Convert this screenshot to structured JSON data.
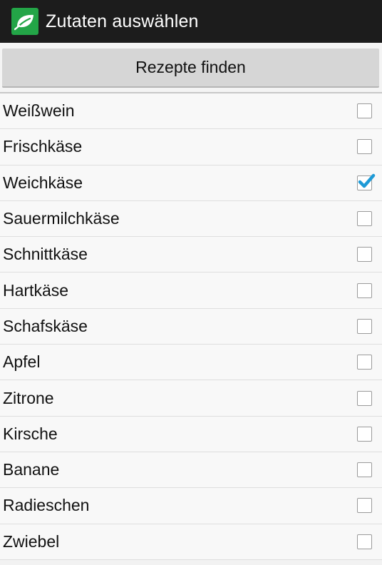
{
  "action_bar": {
    "icon": "leaf-app-icon",
    "title": "Zutaten auswählen",
    "background": "#1c1c1c",
    "icon_color": "#23a547"
  },
  "main": {
    "find_button_label": "Rezepte finden"
  },
  "ingredients": [
    {
      "label": "Weißwein",
      "checked": false
    },
    {
      "label": "Frischkäse",
      "checked": false
    },
    {
      "label": "Weichkäse",
      "checked": true
    },
    {
      "label": "Sauermilchkäse",
      "checked": false
    },
    {
      "label": "Schnittkäse",
      "checked": false
    },
    {
      "label": "Hartkäse",
      "checked": false
    },
    {
      "label": "Schafskäse",
      "checked": false
    },
    {
      "label": "Apfel",
      "checked": false
    },
    {
      "label": "Zitrone",
      "checked": false
    },
    {
      "label": "Kirsche",
      "checked": false
    },
    {
      "label": "Banane",
      "checked": false
    },
    {
      "label": "Radieschen",
      "checked": false
    },
    {
      "label": "Zwiebel",
      "checked": false
    }
  ],
  "colors": {
    "checkmark": "#1e9ad6"
  }
}
